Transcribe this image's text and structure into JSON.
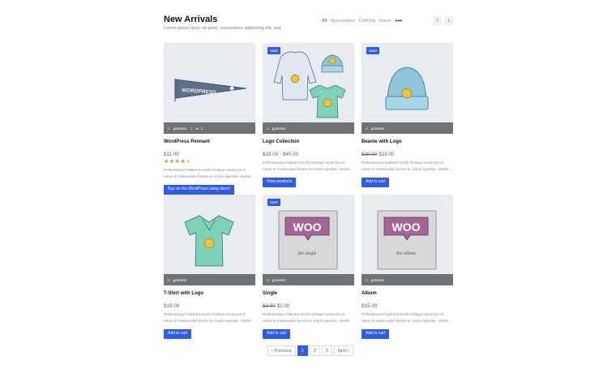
{
  "header": {
    "title": "New Arrivals",
    "subtitle": "Lorem ipsum dolor sit amet, consectetur adipiscing elit, sed",
    "filters": [
      "All",
      "Accessories",
      "Clothing",
      "Decor"
    ],
    "more": "•••",
    "prev_icon": "‹",
    "next_icon": "›"
  },
  "products": [
    {
      "name": "WordPress Pennant",
      "price": "$11.05",
      "author": "gutentor",
      "comments": "1",
      "rating": 4,
      "desc1": "Pellentesque habitant morbi tristique senectus et",
      "desc2": "netus et malesuada fames ac turpis egestas. Vestib...",
      "button": "Buy on the WordPress swag store!",
      "sale": null
    },
    {
      "name": "Logo Collection",
      "price": "$18.00 - $45.00",
      "author": "gutentor",
      "desc1": "Pellentesque habitant morbi tristique senectus et",
      "desc2": "netus et malesuada fames ac turpis egestas. Vestib...",
      "button": "View products",
      "sale": "Sale!"
    },
    {
      "name": "Beanie with Logo",
      "old_price": "$20.00",
      "price": "$18.00",
      "author": "gutentor",
      "desc1": "Pellentesque habitant morbi tristique senectus et",
      "desc2": "netus et malesuada fames ac turpis egestas. Vestib...",
      "button": "Add to cart",
      "sale": "Sale!"
    },
    {
      "name": "T-Shirt with Logo",
      "price": "$18.00",
      "author": "gutentor",
      "desc1": "Pellentesque habitant morbi tristique senectus et",
      "desc2": "netus et malesuada fames ac turpis egestas. Vestib...",
      "button": "Add to cart",
      "sale": null
    },
    {
      "name": "Single",
      "old_price": "$3.00",
      "price": "$2.00",
      "author": "gutentor",
      "desc1": "Pellentesque habitant morbi tristique senectus et",
      "desc2": "netus et malesuada fames ac turpis egestas. Vestib...",
      "button": "Add to cart",
      "sale": "Sale!",
      "woo_sub": "the single"
    },
    {
      "name": "Album",
      "price": "$15.00",
      "author": "gutentor",
      "desc1": "Pellentesque habitant morbi tristique senectus et",
      "desc2": "netus et malesuada fames ac turpis egestas. Vestib...",
      "button": "Add to cart",
      "sale": null,
      "woo_sub": "the album"
    }
  ],
  "woo_text": "WOO",
  "pennant_text": "WORDPRESS",
  "pagination": {
    "prev": "‹ Previous",
    "pages": [
      "1",
      "2",
      "3"
    ],
    "next": "Next ›"
  },
  "colors": {
    "accent": "#2f5ce4",
    "star": "#e4873a",
    "meta_bar": "#64686c"
  },
  "icons": {
    "user": "☺",
    "comment": "●",
    "star": "★"
  }
}
